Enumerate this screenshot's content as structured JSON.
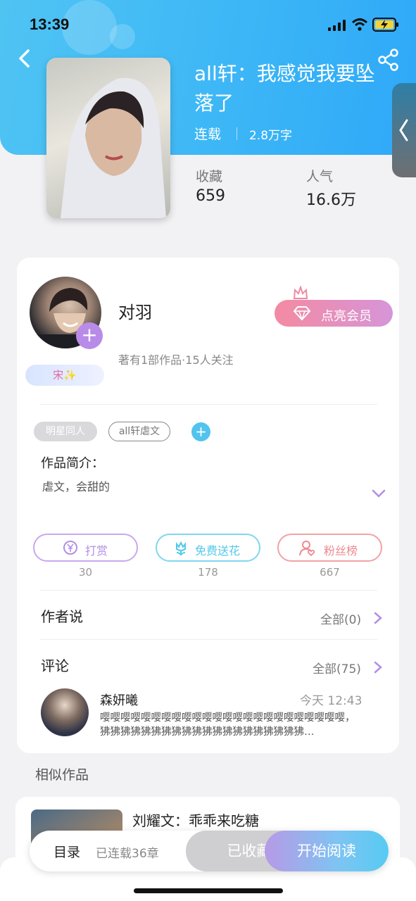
{
  "status_bar": {
    "time": "13:39"
  },
  "book": {
    "title": "all轩：我感觉我要坠落了",
    "status": "连载",
    "word_count": "2.8万字",
    "stats": [
      {
        "label": "收藏",
        "value": "659"
      },
      {
        "label": "人气",
        "value": "16.6万"
      }
    ]
  },
  "author": {
    "name": "对羽",
    "meta": "著有1部作品·15人关注",
    "badge": "宋✨",
    "vip_button": "点亮会员"
  },
  "tags": [
    "明星同人",
    "all轩虐文"
  ],
  "intro": {
    "title": "作品简介：",
    "text": "虐文，会甜的"
  },
  "actions": [
    {
      "label": "打赏",
      "count": "30",
      "color": "#b48ee6"
    },
    {
      "label": "免费送花",
      "count": "178",
      "color": "#52c9ea"
    },
    {
      "label": "粉丝榜",
      "count": "667",
      "color": "#ee8a90"
    }
  ],
  "author_says": {
    "title": "作者说",
    "more": "全部(0)"
  },
  "comments": {
    "title": "评论",
    "more": "全部(75)",
    "items": [
      {
        "name": "森妍曦",
        "time": "今天 12:43",
        "text": "嘤嘤嘤嘤嘤嘤嘤嘤嘤嘤嘤嘤嘤嘤嘤嘤嘤嘤嘤嘤嘤嘤嘤嘤，狒狒狒狒狒狒狒狒狒狒狒狒狒狒狒狒狒狒狒狒…"
      }
    ]
  },
  "similar": {
    "title": "相似作品",
    "items": [
      {
        "title": "刘耀文：乖乖来吃糖"
      }
    ]
  },
  "bottom_bar": {
    "toc": "目录",
    "chapters": "已连载36章",
    "collected": "已收藏",
    "read": "开始阅读"
  }
}
